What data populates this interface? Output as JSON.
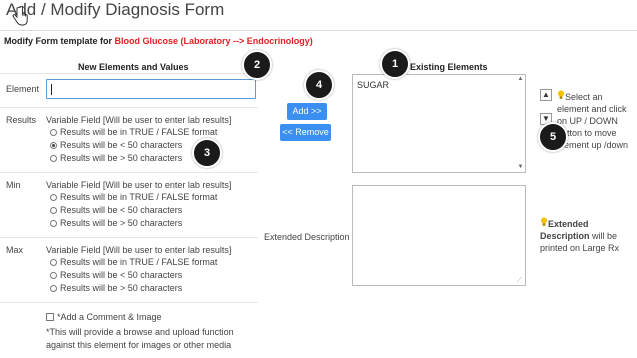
{
  "page_title": "Add / Modify Diagnosis Form",
  "subtitle": {
    "prefix": "Modify Form template for ",
    "highlight": "Blood Glucose (Laboratory --> Endocrinology)"
  },
  "left": {
    "heading": "New Elements and Values",
    "element_label": "Element",
    "element_value": "",
    "variable_field_text": "Variable Field [Will be user to enter lab results]",
    "option_true_false": "Results will be in TRUE / FALSE format",
    "option_lt50": "Results will be < 50 characters",
    "option_gt50": "Results will be > 50 characters",
    "results_label": "Results",
    "min_label": "Min",
    "max_label": "Max",
    "add_comment_label": "*Add a Comment & Image",
    "note_line1": "*This will provide a browse and upload function",
    "note_line2": "against this element for images or other media"
  },
  "middle": {
    "add_button": "Add >>",
    "remove_button": "<< Remove",
    "extended_description_label": "Extended Description"
  },
  "right": {
    "heading": "Existing Elements",
    "existing_items": [
      "SUGAR"
    ],
    "tip_line1": "Select an",
    "tip_line2": "element and click",
    "tip_line3": "on UP / DOWN",
    "tip_line4": "button to move",
    "tip_line5": "element up /down",
    "ext_tip_bold1": "Extended",
    "ext_tip_bold2": "Description",
    "ext_tip_rest1": " will be",
    "ext_tip_rest2": "printed on Large Rx"
  },
  "badges": {
    "b1": "1",
    "b2": "2",
    "b3": "3",
    "b4": "4",
    "b5": "5"
  },
  "colors": {
    "accent_red": "#e02020",
    "button_blue": "#3b8ff0",
    "badge_bg": "#1a1a1a",
    "tip_bulb": "#f2c200"
  }
}
